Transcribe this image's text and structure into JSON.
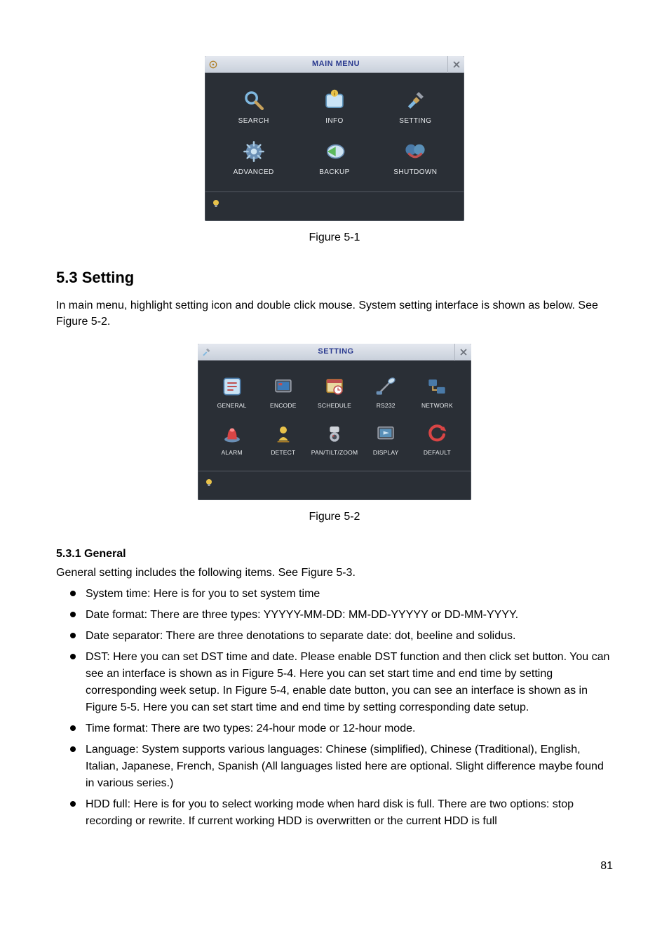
{
  "figure1": {
    "window_title": "MAIN MENU",
    "items": [
      {
        "label": "SEARCH",
        "icon": "search-icon"
      },
      {
        "label": "INFO",
        "icon": "info-icon"
      },
      {
        "label": "SETTING",
        "icon": "setting-icon"
      },
      {
        "label": "ADVANCED",
        "icon": "advanced-icon"
      },
      {
        "label": "BACKUP",
        "icon": "backup-icon"
      },
      {
        "label": "SHUTDOWN",
        "icon": "shutdown-icon"
      }
    ],
    "caption": "Figure 5-1"
  },
  "section": {
    "heading": "5.3  Setting",
    "intro": "In main menu, highlight setting icon and double click mouse. System setting interface is shown as below. See Figure 5-2."
  },
  "figure2": {
    "window_title": "SETTING",
    "items": [
      {
        "label": "GENERAL",
        "icon": "general-icon"
      },
      {
        "label": "ENCODE",
        "icon": "encode-icon"
      },
      {
        "label": "SCHEDULE",
        "icon": "schedule-icon"
      },
      {
        "label": "RS232",
        "icon": "rs232-icon"
      },
      {
        "label": "NETWORK",
        "icon": "network-icon"
      },
      {
        "label": "ALARM",
        "icon": "alarm-icon"
      },
      {
        "label": "DETECT",
        "icon": "detect-icon"
      },
      {
        "label": "PAN/TILT/ZOOM",
        "icon": "ptz-icon"
      },
      {
        "label": "DISPLAY",
        "icon": "display-icon"
      },
      {
        "label": "DEFAULT",
        "icon": "default-icon"
      }
    ],
    "caption": "Figure 5-2"
  },
  "subsection": {
    "heading": "5.3.1  General",
    "intro": "General setting includes the following items. See Figure 5-3.",
    "bullets": [
      "System time: Here is for you to set system time",
      "Date format: There are three types: YYYYY-MM-DD: MM-DD-YYYYY or DD-MM-YYYY.",
      "Date separator: There are three denotations to separate date: dot, beeline and solidus.",
      "DST: Here you can set DST time and date. Please enable DST function and then click set button. You can see an interface is shown as in Figure 5-4. Here you can set start time and end time by setting corresponding week setup. In Figure 5-4, enable date button, you can see an interface is shown as in Figure 5-5. Here you can set start time and end time by setting corresponding date setup.",
      "Time format: There are two types: 24-hour mode or 12-hour mode.",
      "Language: System supports various languages: Chinese (simplified), Chinese (Traditional), English, Italian, Japanese, French, Spanish (All languages listed here are optional. Slight difference maybe found in various series.)",
      "HDD full: Here is for you to select working mode when hard disk is full. There are two options: stop recording or rewrite. If current working HDD is overwritten or the current HDD is full"
    ]
  },
  "page_number": "81"
}
